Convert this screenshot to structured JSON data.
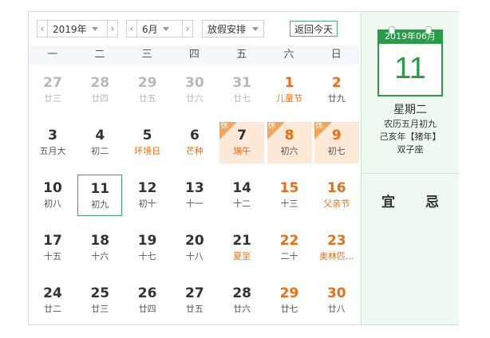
{
  "toolbar": {
    "year_prev": "‹",
    "year_label": "2019年",
    "year_next": "›",
    "month_prev": "‹",
    "month_label": "6月",
    "month_next": "›",
    "holiday_label": "放假安排",
    "today_label": "返回今天"
  },
  "weekdays": [
    "一",
    "二",
    "三",
    "四",
    "五",
    "六",
    "日"
  ],
  "days": [
    {
      "num": "27",
      "lunar": "廿三",
      "type": "prev"
    },
    {
      "num": "28",
      "lunar": "廿四",
      "type": "prev"
    },
    {
      "num": "29",
      "lunar": "廿五",
      "type": "prev"
    },
    {
      "num": "30",
      "lunar": "廿六",
      "type": "prev"
    },
    {
      "num": "31",
      "lunar": "廿七",
      "type": "prev"
    },
    {
      "num": "1",
      "lunar": "儿童节",
      "type": "weekend festival"
    },
    {
      "num": "2",
      "lunar": "廿九",
      "type": "weekend"
    },
    {
      "num": "3",
      "lunar": "五月大",
      "type": ""
    },
    {
      "num": "4",
      "lunar": "初二",
      "type": ""
    },
    {
      "num": "5",
      "lunar": "环境日",
      "type": "festival"
    },
    {
      "num": "6",
      "lunar": "芒种",
      "type": "festival"
    },
    {
      "num": "7",
      "lunar": "端午",
      "type": "festival rest",
      "badge": "休"
    },
    {
      "num": "8",
      "lunar": "初六",
      "type": "weekend rest",
      "badge": "休"
    },
    {
      "num": "9",
      "lunar": "初七",
      "type": "weekend rest",
      "badge": "休"
    },
    {
      "num": "10",
      "lunar": "初八",
      "type": ""
    },
    {
      "num": "11",
      "lunar": "初九",
      "type": "selected"
    },
    {
      "num": "12",
      "lunar": "初十",
      "type": ""
    },
    {
      "num": "13",
      "lunar": "十一",
      "type": ""
    },
    {
      "num": "14",
      "lunar": "十二",
      "type": ""
    },
    {
      "num": "15",
      "lunar": "十三",
      "type": "weekend"
    },
    {
      "num": "16",
      "lunar": "父亲节",
      "type": "weekend festival"
    },
    {
      "num": "17",
      "lunar": "十五",
      "type": ""
    },
    {
      "num": "18",
      "lunar": "十六",
      "type": ""
    },
    {
      "num": "19",
      "lunar": "十七",
      "type": ""
    },
    {
      "num": "20",
      "lunar": "十八",
      "type": ""
    },
    {
      "num": "21",
      "lunar": "夏至",
      "type": "festival"
    },
    {
      "num": "22",
      "lunar": "二十",
      "type": "weekend"
    },
    {
      "num": "23",
      "lunar": "奥林匹...",
      "type": "weekend festival"
    },
    {
      "num": "24",
      "lunar": "廿二",
      "type": ""
    },
    {
      "num": "25",
      "lunar": "廿三",
      "type": ""
    },
    {
      "num": "26",
      "lunar": "廿四",
      "type": ""
    },
    {
      "num": "27",
      "lunar": "廿五",
      "type": ""
    },
    {
      "num": "28",
      "lunar": "廿六",
      "type": ""
    },
    {
      "num": "29",
      "lunar": "廿七",
      "type": "weekend"
    },
    {
      "num": "30",
      "lunar": "廿八",
      "type": "weekend"
    }
  ],
  "side": {
    "header": "2019年06月",
    "day": "11",
    "weekday": "星期二",
    "lunar_date": "农历五月初九",
    "zodiac": "己亥年【猪年】",
    "constellation": "双子座",
    "yi": "宜",
    "ji": "忌"
  },
  "colors": {
    "accent_green": "#2a9b48",
    "holiday_orange": "#ef6d10",
    "rest_bg": "#fde9d8"
  }
}
